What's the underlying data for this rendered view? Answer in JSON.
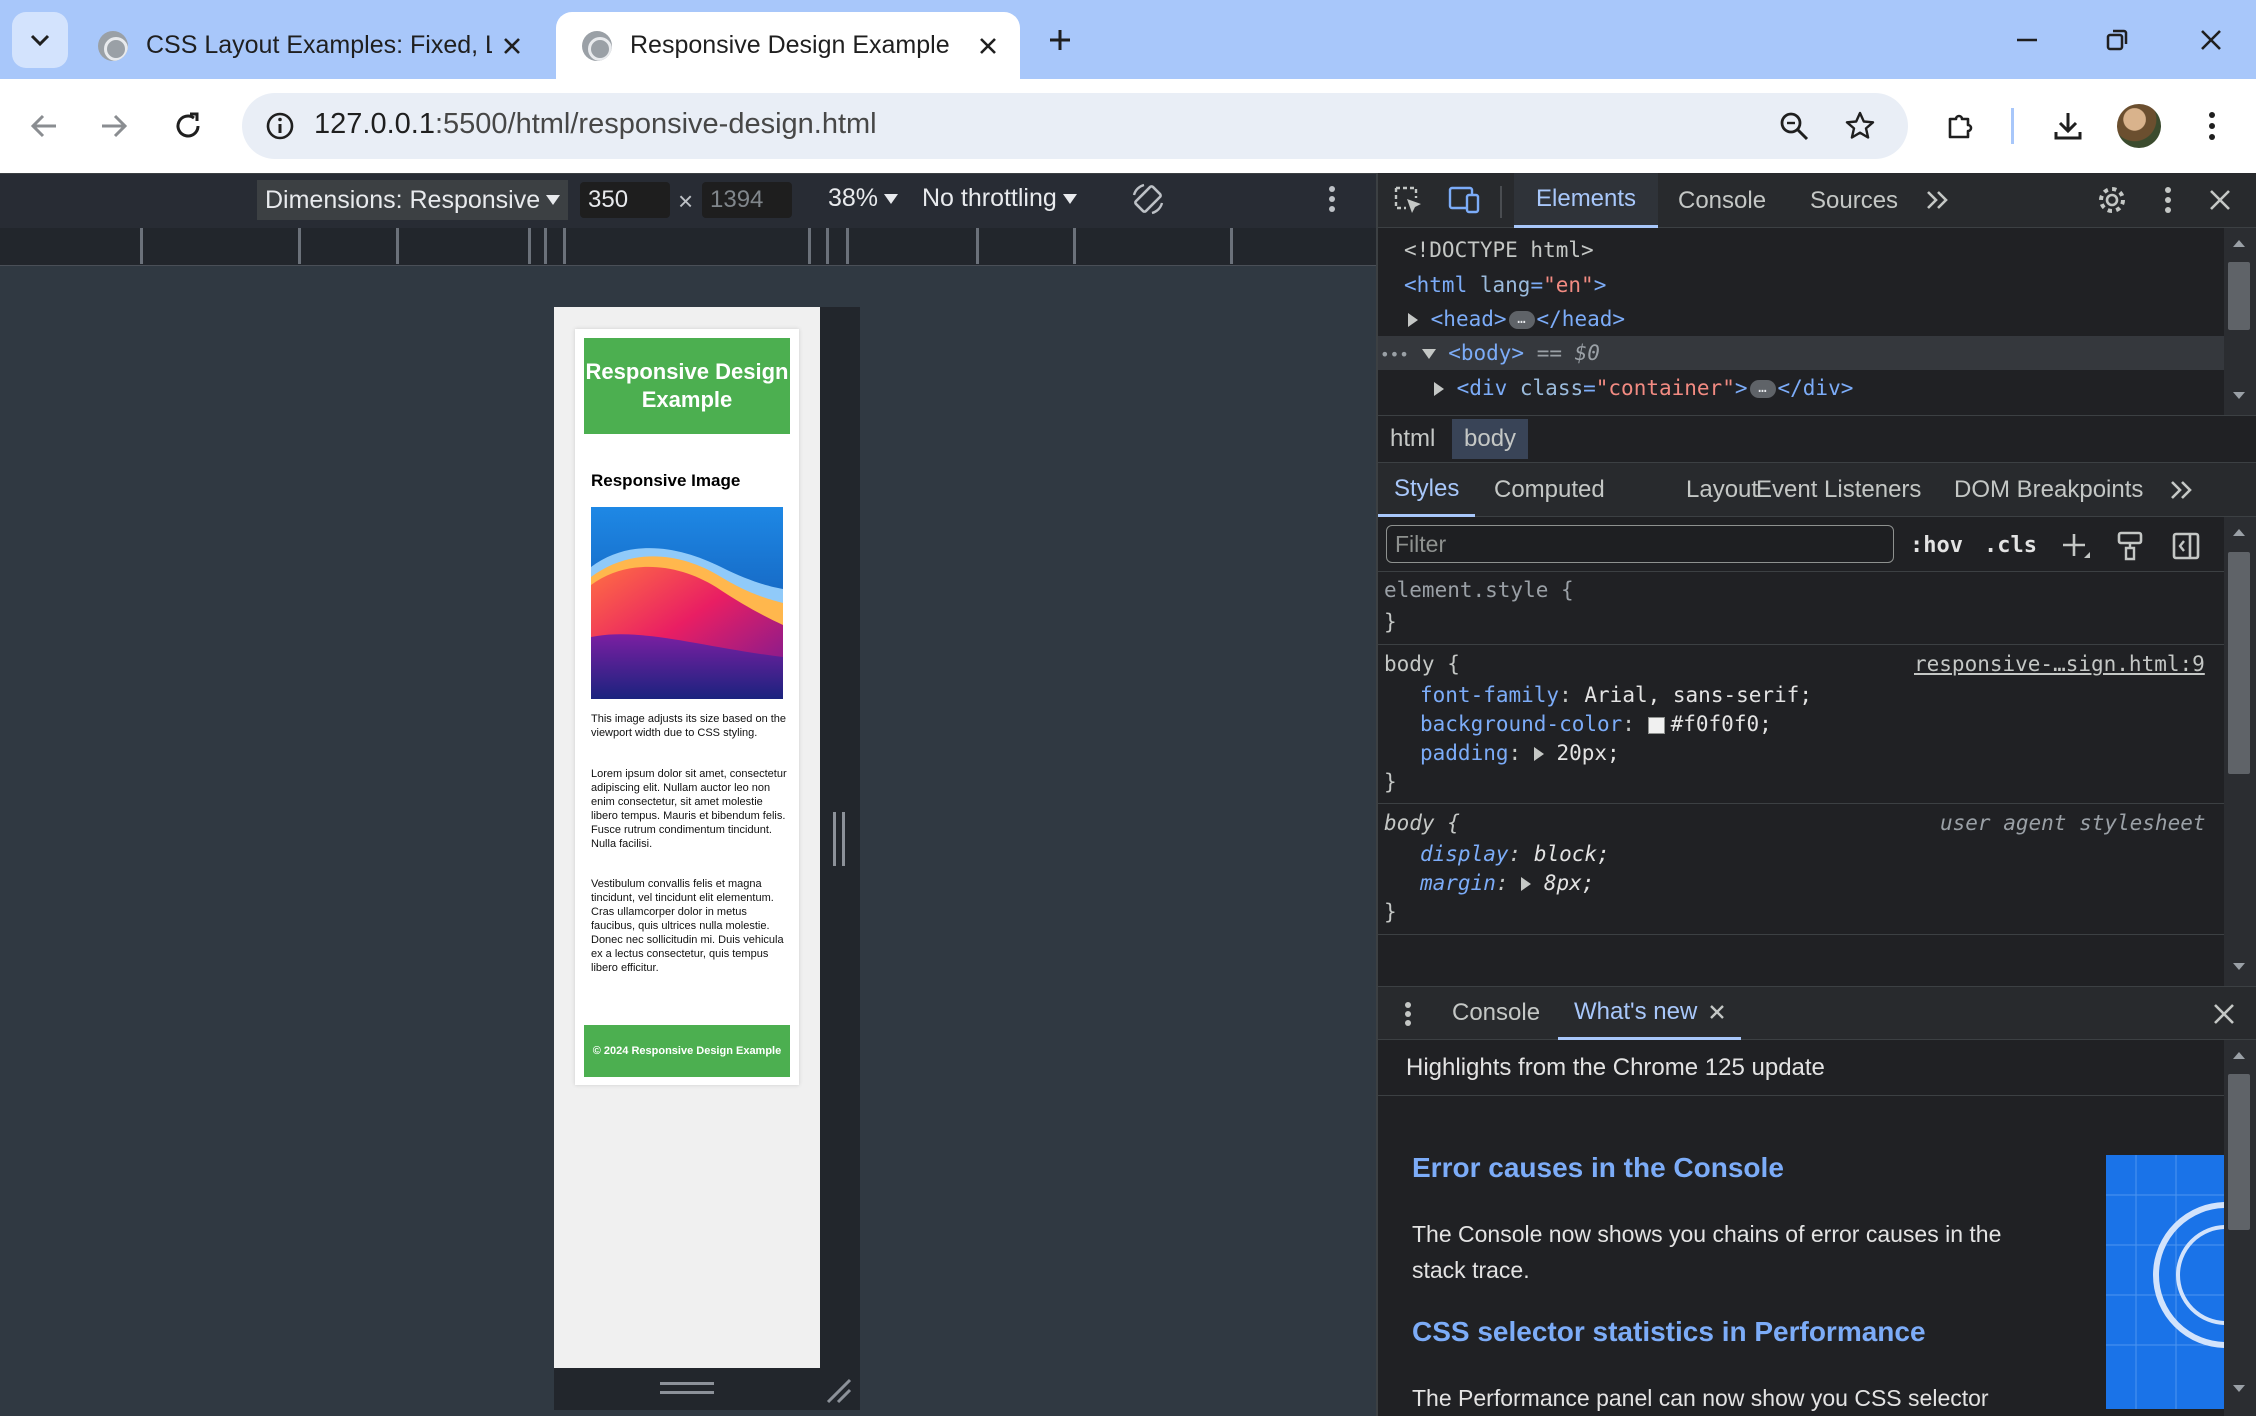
{
  "browser": {
    "tabs": [
      {
        "title": "CSS Layout Examples: Fixed, Liquid",
        "active": false
      },
      {
        "title": "Responsive Design Example",
        "active": true
      }
    ],
    "new_tab_label": "+",
    "address": {
      "host": "127.0.0.1",
      "rest": ":5500/html/responsive-design.html"
    }
  },
  "device_toolbar": {
    "dimensions_label": "Dimensions: Responsive",
    "width": "350",
    "height_placeholder": "1394",
    "times": "×",
    "zoom": "38%",
    "throttling": "No throttling"
  },
  "emulated_page": {
    "header": "Responsive Design Example",
    "section_title": "Responsive Image",
    "image_caption": "This image adjusts its size based on the viewport width due to CSS styling.",
    "para1": "Lorem ipsum dolor sit amet, consectetur adipiscing elit. Nullam auctor leo non enim consectetur, sit amet molestie libero tempus. Mauris et bibendum felis. Fusce rutrum condimentum tincidunt. Nulla facilisi.",
    "para2": "Vestibulum convallis felis et magna tincidunt, vel tincidunt elit elementum. Cras ullamcorper dolor in metus faucibus, quis ultrices nulla molestie. Donec nec sollicitudin mi. Duis vehicula ex a lectus consectetur, quis tempus libero efficitur.",
    "footer": "© 2024 Responsive Design Example"
  },
  "devtools": {
    "tabs": [
      "Elements",
      "Console",
      "Sources"
    ],
    "active_tab": "Elements",
    "dom": {
      "doctype": "<!DOCTYPE html>",
      "html_open": "<html",
      "html_attr": "lang",
      "html_attr_val": "\"en\"",
      "html_close": ">",
      "head_open": "<head>",
      "head_close": "</head>",
      "body": "<body>",
      "body_ref": "== $0",
      "div_open": "<div",
      "div_attr": "class",
      "div_attr_val": "\"container\"",
      "div_close": "</div>",
      "gt": ">",
      "eq": "=",
      "ellipsis": "…",
      "dots": "•••"
    },
    "breadcrumbs": [
      "html",
      "body"
    ],
    "style_tabs": [
      "Styles",
      "Computed",
      "Layout",
      "Event Listeners",
      "DOM Breakpoints"
    ],
    "filter_placeholder": "Filter",
    "hov_label": ":hov",
    "cls_label": ".cls",
    "rules": {
      "element_style": "element.style {",
      "close_brace": "}",
      "body_selector": "body {",
      "body_source": "responsive-…sign.html:9",
      "font_family_prop": "font-family",
      "font_family_val": "Arial, sans-serif;",
      "bg_prop": "background-color",
      "bg_val": "#f0f0f0;",
      "padding_prop": "padding",
      "padding_val": "20px;",
      "colon": ":",
      "ua_selector": "body {",
      "ua_source": "user agent stylesheet",
      "display_prop": "display",
      "display_val": "block;",
      "margin_prop": "margin",
      "margin_val": "8px;"
    },
    "drawer": {
      "tabs": [
        "Console",
        "What's new"
      ],
      "subtitle": "Highlights from the Chrome 125 update",
      "h1": "Error causes in the Console",
      "p1": "The Console now shows you chains of error causes in the stack trace.",
      "h2": "CSS selector statistics in Performance",
      "p2": "The Performance panel can now show you CSS selector"
    }
  }
}
